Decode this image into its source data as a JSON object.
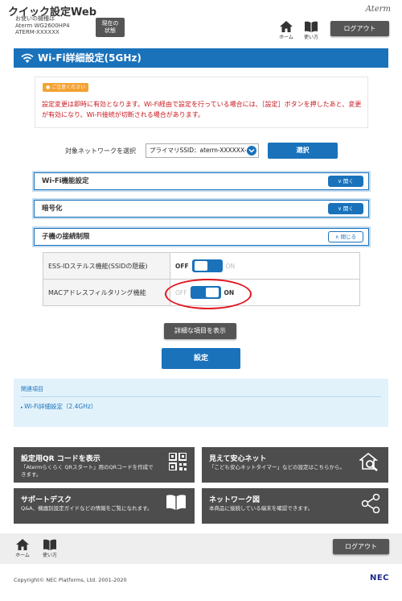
{
  "header": {
    "app_title": "クイック設定Web",
    "device_line1": "お使いの機種は",
    "device_line2": "Aterm WG2600HP4",
    "device_line3": "ATERM-XXXXXX",
    "status_btn_line1": "現在の",
    "status_btn_line2": "状態",
    "brand": "Aterm",
    "home_label": "ホーム",
    "manual_label": "使い方",
    "logout_label": "ログアウト"
  },
  "page": {
    "title": "Wi-Fi詳細設定(5GHz)"
  },
  "notice": {
    "badge": "ご注意ください",
    "text": "設定変更は即時に有効となります。Wi-Fi経由で設定を行っている場合には、［設定］ボタンを押したあと、変更が有効になり、Wi-Fi接続が切断される場合があります。"
  },
  "network_select": {
    "label": "対象ネットワークを選択",
    "value": "プライマリSSID：aterm-XXXXXX-a",
    "button": "選択"
  },
  "sections": [
    {
      "title": "Wi-Fi機能設定",
      "toggle": "開く",
      "state": "collapsed"
    },
    {
      "title": "暗号化",
      "toggle": "開く",
      "state": "collapsed"
    },
    {
      "title": "子機の接続制限",
      "toggle": "閉じる",
      "state": "expanded"
    }
  ],
  "settings": [
    {
      "label": "ESS-IDステルス機能(SSIDの隠蔽)",
      "off": "OFF",
      "on": "ON",
      "value": "OFF"
    },
    {
      "label": "MACアドレスフィルタリング機能",
      "off": "OFF",
      "on": "ON",
      "value": "ON"
    }
  ],
  "buttons": {
    "detail": "詳細な項目を表示",
    "apply": "設定"
  },
  "related": {
    "title": "関連項目",
    "link": "Wi-Fi詳細設定（2.4GHz）"
  },
  "tiles": [
    {
      "title": "設定用QR コードを表示",
      "desc": "「Atermらくらく QRスタート」用のQRコードを作成できます。",
      "icon": "qr-code-icon"
    },
    {
      "title": "見えて安心ネット",
      "desc": "「こども安心ネットタイマー」などの設定はこちらから。",
      "icon": "home-search-icon"
    },
    {
      "title": "サポートデスク",
      "desc": "Q&A、機器別設定ガイドなどの情報をご覧になれます。",
      "icon": "book-icon"
    },
    {
      "title": "ネットワーク図",
      "desc": "本商品に接続している端末を確認できます。",
      "icon": "network-icon"
    }
  ],
  "footer": {
    "home_label": "ホーム",
    "manual_label": "使い方",
    "logout_label": "ログアウト",
    "copyright": "Copyright© NEC Platforms, Ltd. 2001-2020",
    "brand": "NEC"
  },
  "colors": {
    "primary_blue": "#1a72bb",
    "dark_button": "#555555",
    "warning_red": "#c8161d",
    "highlight_red": "#e1141e",
    "notice_orange": "#f4a233"
  }
}
